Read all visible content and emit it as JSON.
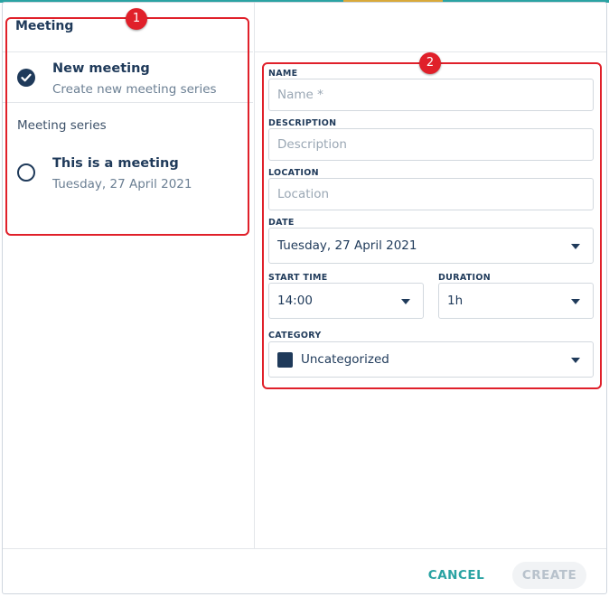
{
  "colors": {
    "primary": "#1f3a5a",
    "accent": "#2aa3a3",
    "annotation": "#e0202a",
    "category_swatch": "#1f3a5a"
  },
  "left": {
    "title": "Meeting",
    "new_meeting": {
      "name": "New meeting",
      "sub": "Create new meeting series",
      "selected": true
    },
    "section_label": "Meeting series",
    "series_item": {
      "name": "This is a meeting",
      "sub": "Tuesday, 27 April 2021",
      "selected": false
    }
  },
  "form": {
    "name": {
      "label": "NAME",
      "placeholder": "Name *",
      "value": ""
    },
    "description": {
      "label": "DESCRIPTION",
      "placeholder": "Description",
      "value": ""
    },
    "location": {
      "label": "LOCATION",
      "placeholder": "Location",
      "value": ""
    },
    "date": {
      "label": "DATE",
      "value": "Tuesday, 27 April 2021"
    },
    "start_time": {
      "label": "START TIME",
      "value": "14:00"
    },
    "duration": {
      "label": "DURATION",
      "value": "1h"
    },
    "category": {
      "label": "CATEGORY",
      "value": "Uncategorized"
    }
  },
  "footer": {
    "cancel": "CANCEL",
    "create": "CREATE"
  },
  "annotations": {
    "badge_1": "1",
    "badge_2": "2"
  }
}
